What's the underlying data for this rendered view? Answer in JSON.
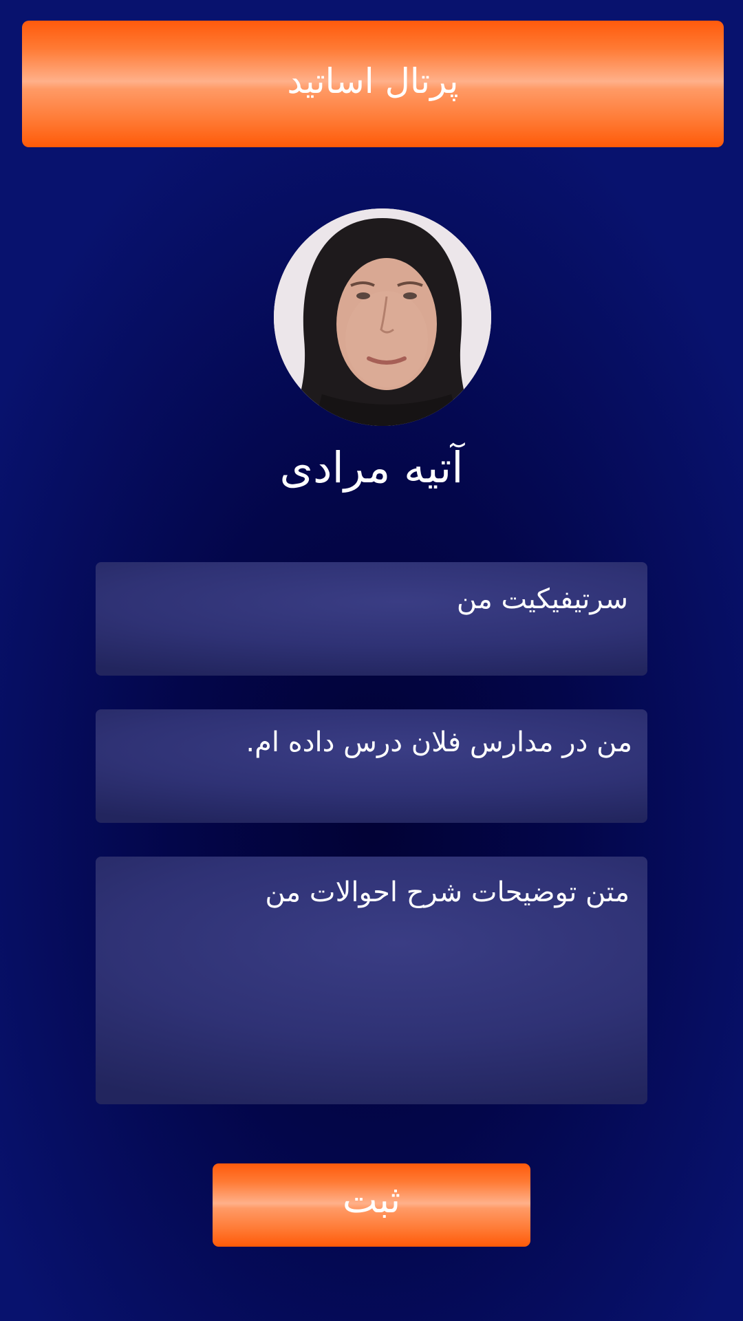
{
  "header": {
    "title": "پرتال اساتید"
  },
  "profile": {
    "avatar_icon": "user-photo",
    "name": "آتیه مرادی"
  },
  "fields": {
    "certificate": "سرتیفیکیت من",
    "teaching_history": "من در مدارس فلان درس داده ام.",
    "bio": "متن توضیحات شرح احوالات من"
  },
  "actions": {
    "submit_label": "ثبت"
  },
  "colors": {
    "background": "#03064a",
    "accent_orange": "#ff5a0c",
    "field_bg": "#2f3275",
    "text": "#ffffff"
  }
}
